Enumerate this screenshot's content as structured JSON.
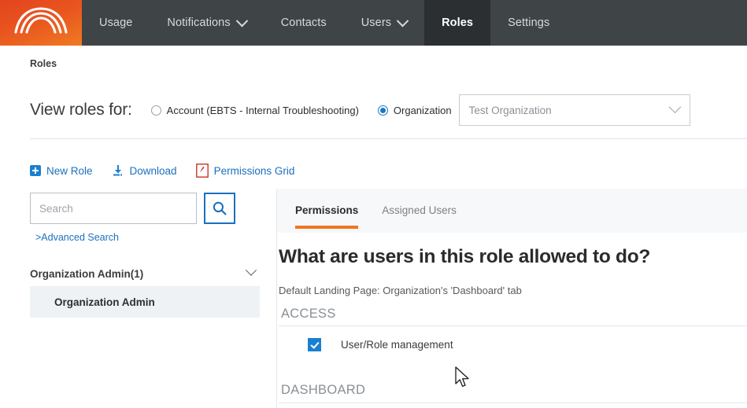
{
  "topnav": {
    "logo_name": "arcs-logo",
    "items": [
      {
        "label": "Usage",
        "active": false,
        "has_caret": false
      },
      {
        "label": "Notifications",
        "active": false,
        "has_caret": true
      },
      {
        "label": "Contacts",
        "active": false,
        "has_caret": false
      },
      {
        "label": "Users",
        "active": false,
        "has_caret": true
      },
      {
        "label": "Roles",
        "active": true,
        "has_caret": false
      },
      {
        "label": "Settings",
        "active": false,
        "has_caret": false
      }
    ]
  },
  "breadcrumb": {
    "text": "Roles"
  },
  "filter": {
    "label": "View roles for:",
    "radio_account": "Account (EBTS - Internal Troubleshooting)",
    "radio_organization": "Organization",
    "selected": "Organization",
    "org_value": "Test Organization"
  },
  "actions": {
    "new_role": "New Role",
    "download": "Download",
    "permissions_grid": "Permissions Grid"
  },
  "sidebar": {
    "search_placeholder": "Search",
    "search_value": "",
    "advanced_search": ">Advanced Search",
    "group_title": "Organization Admin(1)",
    "roles": [
      {
        "label": "Organization Admin",
        "selected": true
      }
    ]
  },
  "tabs": [
    {
      "label": "Permissions",
      "active": true
    },
    {
      "label": "Assigned Users",
      "active": false
    }
  ],
  "main": {
    "question": "What are users in this role allowed to do?",
    "landing_page": "Default Landing Page: Organization's 'Dashboard' tab",
    "sections": [
      {
        "title": "ACCESS",
        "permissions": [
          {
            "label": "User/Role management",
            "checked": true
          }
        ]
      },
      {
        "title": "DASHBOARD",
        "permissions": []
      }
    ]
  },
  "colors": {
    "header_bg": "#3f4447",
    "header_active_bg": "#2b2f31",
    "brand_orange": "#e9551f",
    "tab_accent": "#ee7623",
    "link_blue": "#1b6fc0",
    "checkbox_blue": "#1b7fd1",
    "pdf_red": "#c8342a",
    "selected_row_bg": "#eef2f5"
  }
}
